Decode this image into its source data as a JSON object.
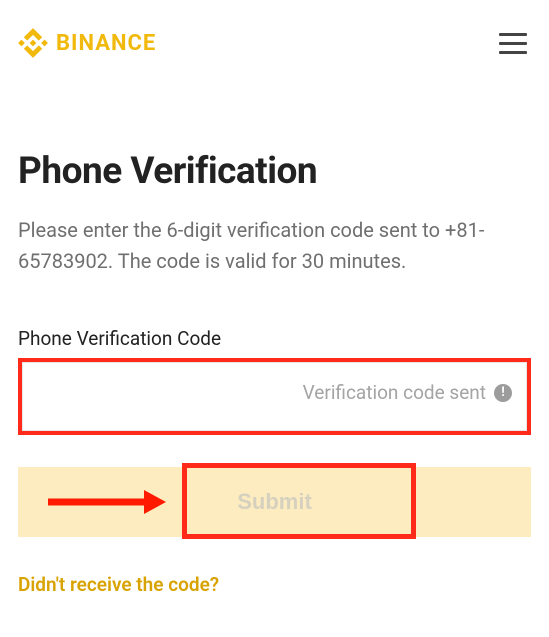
{
  "brand": {
    "name": "BINANCE",
    "color": "#F0B90B"
  },
  "page": {
    "title": "Phone Verification",
    "description": "Please enter the 6-digit verification code sent to +81-65783902. The code is valid for 30 minutes.",
    "field_label": "Phone Verification Code",
    "sent_status": "Verification code sent",
    "submit_label": "Submit",
    "help_link": "Didn't receive the code?"
  }
}
